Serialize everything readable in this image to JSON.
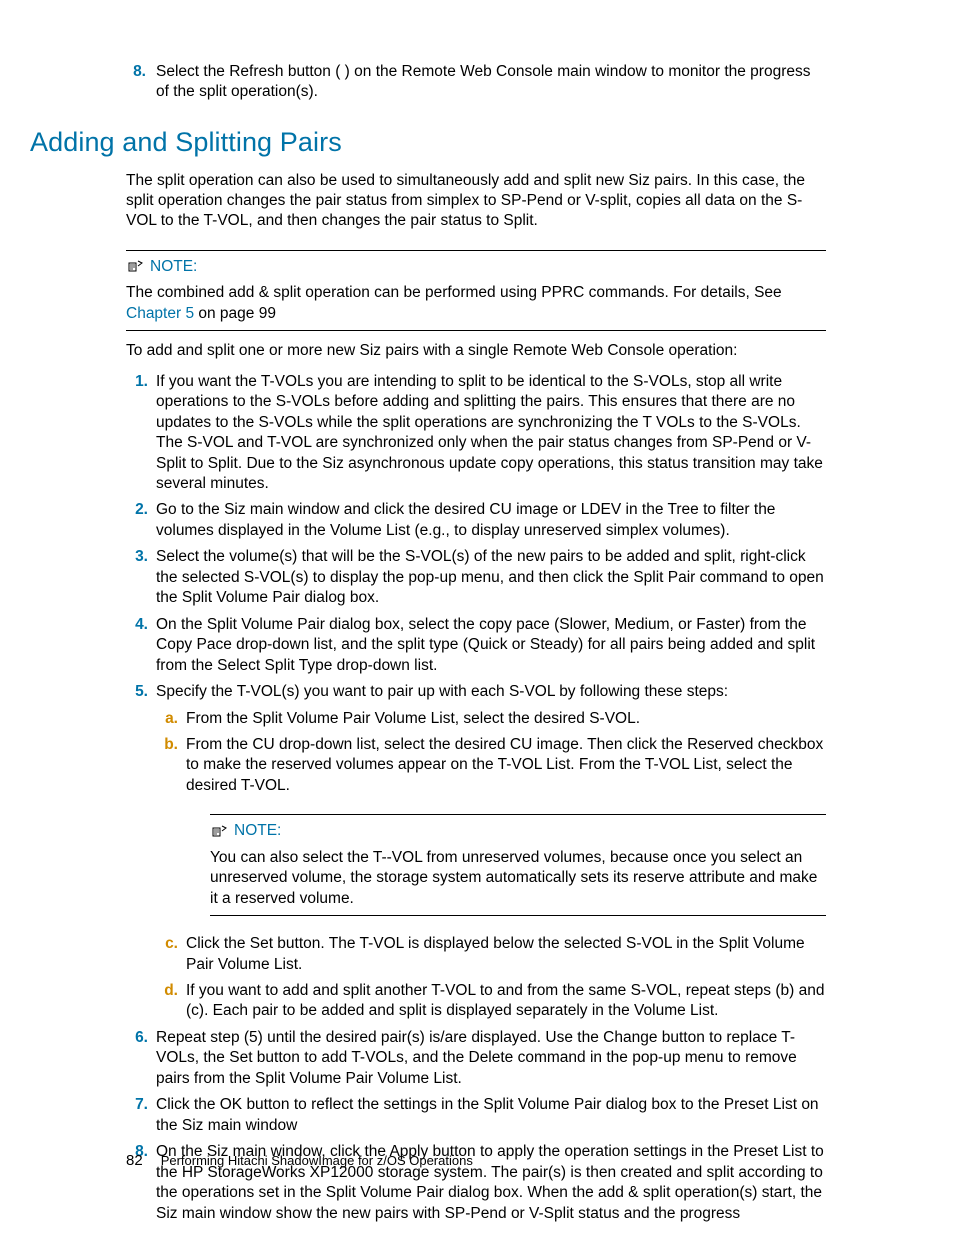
{
  "intro_step": {
    "num": "8.",
    "text": "Select the Refresh button ( ) on the Remote Web Console main window to monitor the progress of the split operation(s)."
  },
  "section_title": "Adding and Splitting Pairs",
  "intro_para": "The split operation can also be used to simultaneously add and split new Siz pairs. In this case, the split operation changes the pair status from simplex to SP-Pend or V-split, copies all data on the S-VOL to the T-VOL, and then changes the pair status to Split.",
  "note1": {
    "label": "NOTE:",
    "text_pre": "The combined add & split operation can be performed using PPRC commands. For details, See ",
    "link": "Chapter 5",
    "text_post": " on page 99"
  },
  "lead_in": "To add and split one or more new Siz pairs with a single Remote Web Console operation:",
  "steps": [
    {
      "n": "1.",
      "t": "If you want the T-VOLs you are intending to split to be identical to the S-VOLs, stop all write operations to the S-VOLs before adding and splitting the pairs. This ensures that there are no updates to the S-VOLs while the split operations are synchronizing the T VOLs to the S-VOLs. The S-VOL and T-VOL are synchronized only when the pair status changes from SP-Pend or V-Split to Split. Due to the Siz asynchronous update copy operations, this status transition may take several minutes."
    },
    {
      "n": "2.",
      "t": "Go to the Siz main window and click the desired CU image or LDEV in the Tree to filter the volumes displayed in the Volume List (e.g., to display unreserved simplex volumes)."
    },
    {
      "n": "3.",
      "t": "Select the volume(s) that will be the S-VOL(s) of the new pairs to be added and split, right-click the selected S-VOL(s) to display the pop-up menu, and then click the Split Pair command to open the Split Volume Pair dialog box."
    },
    {
      "n": "4.",
      "t": "On the Split Volume Pair dialog box, select the copy pace (Slower, Medium, or Faster) from the Copy Pace drop-down list, and the split type (Quick or Steady) for all pairs being added and split from the Select Split Type drop-down list."
    },
    {
      "n": "5.",
      "t": "Specify the T-VOL(s) you want to pair up with each S-VOL by following these steps:"
    }
  ],
  "substeps5": [
    {
      "n": "a.",
      "t": "From the Split Volume Pair Volume List, select the desired S-VOL."
    },
    {
      "n": "b.",
      "t": "From the CU drop-down list, select the desired CU image. Then click the Reserved checkbox to make the reserved volumes appear on the T-VOL List. From the T-VOL List, select the desired T-VOL."
    }
  ],
  "note2": {
    "label": "NOTE:",
    "text": "You can also select the T--VOL from unreserved volumes, because once you select an unreserved volume, the storage system automatically sets its reserve attribute and make it a reserved volume."
  },
  "substeps5b": [
    {
      "n": "c.",
      "t": "Click the Set button. The T-VOL is displayed below the selected S-VOL in the Split Volume Pair Volume List."
    },
    {
      "n": "d.",
      "t": "If you want to add and split another T-VOL to and from the same S-VOL, repeat steps (b) and (c). Each pair to be added and split is displayed separately in the Volume List."
    }
  ],
  "steps_tail": [
    {
      "n": "6.",
      "t": "Repeat step (5) until the desired pair(s) is/are displayed. Use the Change button to replace T-VOLs, the Set button to add T-VOLs, and the Delete command in the pop-up menu to remove pairs from the Split Volume Pair Volume List."
    },
    {
      "n": "7.",
      "t": "Click the OK button to reflect the settings in the Split Volume Pair dialog box to the Preset List on the Siz main window"
    },
    {
      "n": "8.",
      "t": "On the Siz main window, click the Apply button to apply the operation settings in the Preset List to the HP StorageWorks XP12000 storage system. The pair(s) is then created and split according to the operations set in the Split Volume Pair dialog box. When the add & split operation(s) start, the Siz main window show the new pairs with SP-Pend or V-Split status and the progress"
    }
  ],
  "footer": {
    "page": "82",
    "title": "Performing Hitachi ShadowImage for z/OS Operations"
  }
}
